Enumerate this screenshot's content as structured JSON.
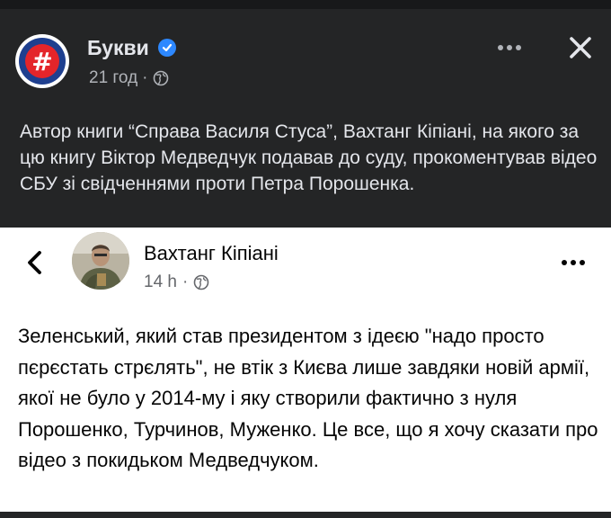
{
  "post": {
    "page_name": "Букви",
    "time": "21 год",
    "privacy_icon": "globe-icon",
    "verified_icon": "verified-check-icon",
    "caption": "Автор книги “Справа Василя Стуса”,  Вахтанг Кіпіані, на якого за цю книгу Віктор Медведчук подавав до суду, прокоментував відео СБУ зі свідченнями проти Петра Порошенка.",
    "colors": {
      "background": "#242526",
      "text": "#e4e6eb",
      "muted": "#b0b3b8",
      "verified": "#2d88ff",
      "avatar_red": "#e4252a",
      "avatar_blue": "#1e3f8f"
    }
  },
  "embedded": {
    "author_name": "Вахтанг Кіпіані",
    "time": "14 h",
    "separator": "·",
    "privacy_icon": "globe-icon",
    "text": "Зеленський, який став президентом з ідеєю \"надо просто пєрєстать стрєлять\", не втік з Києва лише завдяки новій армії, якої не було у 2014-му і яку створили фактично з нуля Порошенко, Турчинов, Муженко. Це все, що я хочу сказати про відео з покидьком Медведчуком."
  }
}
